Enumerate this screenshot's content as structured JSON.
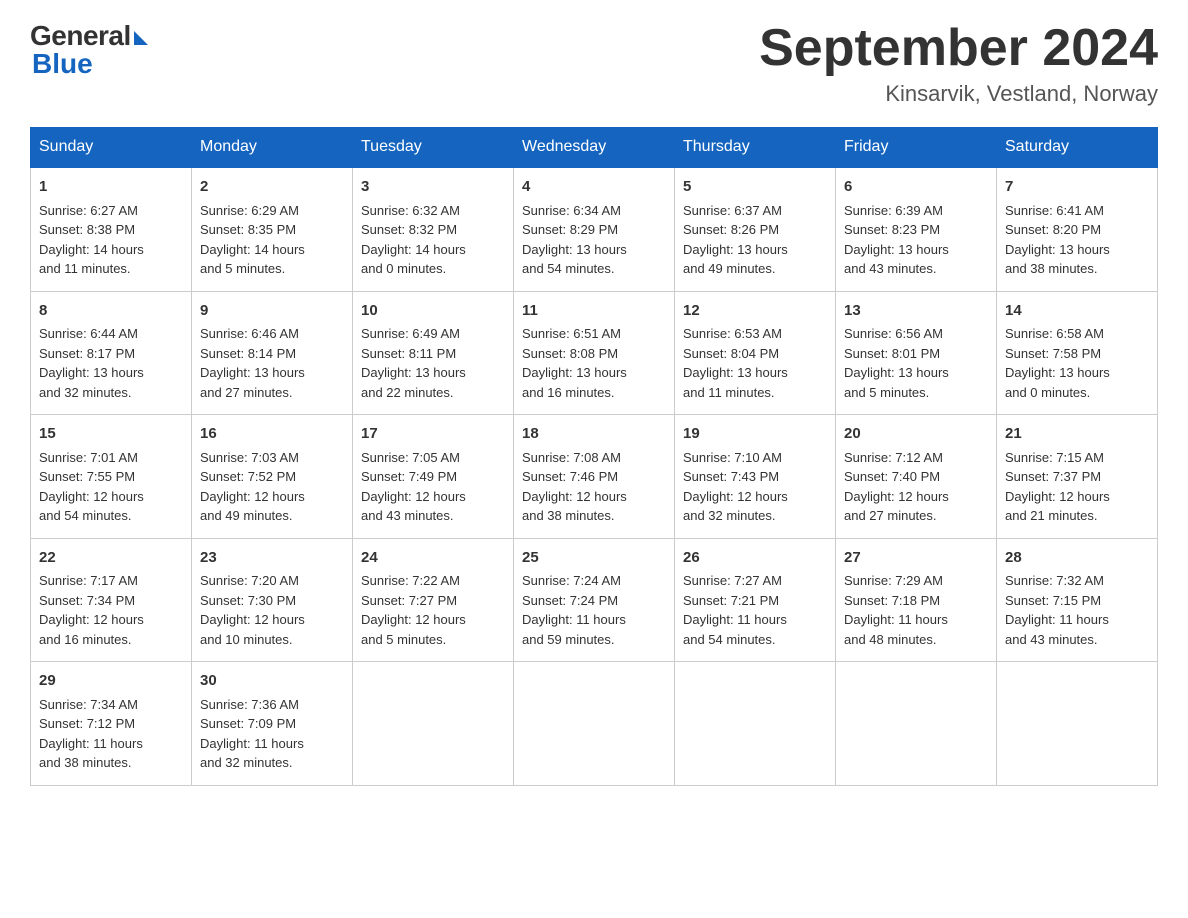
{
  "logo": {
    "general": "General",
    "blue": "Blue"
  },
  "title": "September 2024",
  "location": "Kinsarvik, Vestland, Norway",
  "weekdays": [
    "Sunday",
    "Monday",
    "Tuesday",
    "Wednesday",
    "Thursday",
    "Friday",
    "Saturday"
  ],
  "weeks": [
    [
      {
        "day": "1",
        "info": "Sunrise: 6:27 AM\nSunset: 8:38 PM\nDaylight: 14 hours\nand 11 minutes."
      },
      {
        "day": "2",
        "info": "Sunrise: 6:29 AM\nSunset: 8:35 PM\nDaylight: 14 hours\nand 5 minutes."
      },
      {
        "day": "3",
        "info": "Sunrise: 6:32 AM\nSunset: 8:32 PM\nDaylight: 14 hours\nand 0 minutes."
      },
      {
        "day": "4",
        "info": "Sunrise: 6:34 AM\nSunset: 8:29 PM\nDaylight: 13 hours\nand 54 minutes."
      },
      {
        "day": "5",
        "info": "Sunrise: 6:37 AM\nSunset: 8:26 PM\nDaylight: 13 hours\nand 49 minutes."
      },
      {
        "day": "6",
        "info": "Sunrise: 6:39 AM\nSunset: 8:23 PM\nDaylight: 13 hours\nand 43 minutes."
      },
      {
        "day": "7",
        "info": "Sunrise: 6:41 AM\nSunset: 8:20 PM\nDaylight: 13 hours\nand 38 minutes."
      }
    ],
    [
      {
        "day": "8",
        "info": "Sunrise: 6:44 AM\nSunset: 8:17 PM\nDaylight: 13 hours\nand 32 minutes."
      },
      {
        "day": "9",
        "info": "Sunrise: 6:46 AM\nSunset: 8:14 PM\nDaylight: 13 hours\nand 27 minutes."
      },
      {
        "day": "10",
        "info": "Sunrise: 6:49 AM\nSunset: 8:11 PM\nDaylight: 13 hours\nand 22 minutes."
      },
      {
        "day": "11",
        "info": "Sunrise: 6:51 AM\nSunset: 8:08 PM\nDaylight: 13 hours\nand 16 minutes."
      },
      {
        "day": "12",
        "info": "Sunrise: 6:53 AM\nSunset: 8:04 PM\nDaylight: 13 hours\nand 11 minutes."
      },
      {
        "day": "13",
        "info": "Sunrise: 6:56 AM\nSunset: 8:01 PM\nDaylight: 13 hours\nand 5 minutes."
      },
      {
        "day": "14",
        "info": "Sunrise: 6:58 AM\nSunset: 7:58 PM\nDaylight: 13 hours\nand 0 minutes."
      }
    ],
    [
      {
        "day": "15",
        "info": "Sunrise: 7:01 AM\nSunset: 7:55 PM\nDaylight: 12 hours\nand 54 minutes."
      },
      {
        "day": "16",
        "info": "Sunrise: 7:03 AM\nSunset: 7:52 PM\nDaylight: 12 hours\nand 49 minutes."
      },
      {
        "day": "17",
        "info": "Sunrise: 7:05 AM\nSunset: 7:49 PM\nDaylight: 12 hours\nand 43 minutes."
      },
      {
        "day": "18",
        "info": "Sunrise: 7:08 AM\nSunset: 7:46 PM\nDaylight: 12 hours\nand 38 minutes."
      },
      {
        "day": "19",
        "info": "Sunrise: 7:10 AM\nSunset: 7:43 PM\nDaylight: 12 hours\nand 32 minutes."
      },
      {
        "day": "20",
        "info": "Sunrise: 7:12 AM\nSunset: 7:40 PM\nDaylight: 12 hours\nand 27 minutes."
      },
      {
        "day": "21",
        "info": "Sunrise: 7:15 AM\nSunset: 7:37 PM\nDaylight: 12 hours\nand 21 minutes."
      }
    ],
    [
      {
        "day": "22",
        "info": "Sunrise: 7:17 AM\nSunset: 7:34 PM\nDaylight: 12 hours\nand 16 minutes."
      },
      {
        "day": "23",
        "info": "Sunrise: 7:20 AM\nSunset: 7:30 PM\nDaylight: 12 hours\nand 10 minutes."
      },
      {
        "day": "24",
        "info": "Sunrise: 7:22 AM\nSunset: 7:27 PM\nDaylight: 12 hours\nand 5 minutes."
      },
      {
        "day": "25",
        "info": "Sunrise: 7:24 AM\nSunset: 7:24 PM\nDaylight: 11 hours\nand 59 minutes."
      },
      {
        "day": "26",
        "info": "Sunrise: 7:27 AM\nSunset: 7:21 PM\nDaylight: 11 hours\nand 54 minutes."
      },
      {
        "day": "27",
        "info": "Sunrise: 7:29 AM\nSunset: 7:18 PM\nDaylight: 11 hours\nand 48 minutes."
      },
      {
        "day": "28",
        "info": "Sunrise: 7:32 AM\nSunset: 7:15 PM\nDaylight: 11 hours\nand 43 minutes."
      }
    ],
    [
      {
        "day": "29",
        "info": "Sunrise: 7:34 AM\nSunset: 7:12 PM\nDaylight: 11 hours\nand 38 minutes."
      },
      {
        "day": "30",
        "info": "Sunrise: 7:36 AM\nSunset: 7:09 PM\nDaylight: 11 hours\nand 32 minutes."
      },
      {
        "day": "",
        "info": ""
      },
      {
        "day": "",
        "info": ""
      },
      {
        "day": "",
        "info": ""
      },
      {
        "day": "",
        "info": ""
      },
      {
        "day": "",
        "info": ""
      }
    ]
  ]
}
